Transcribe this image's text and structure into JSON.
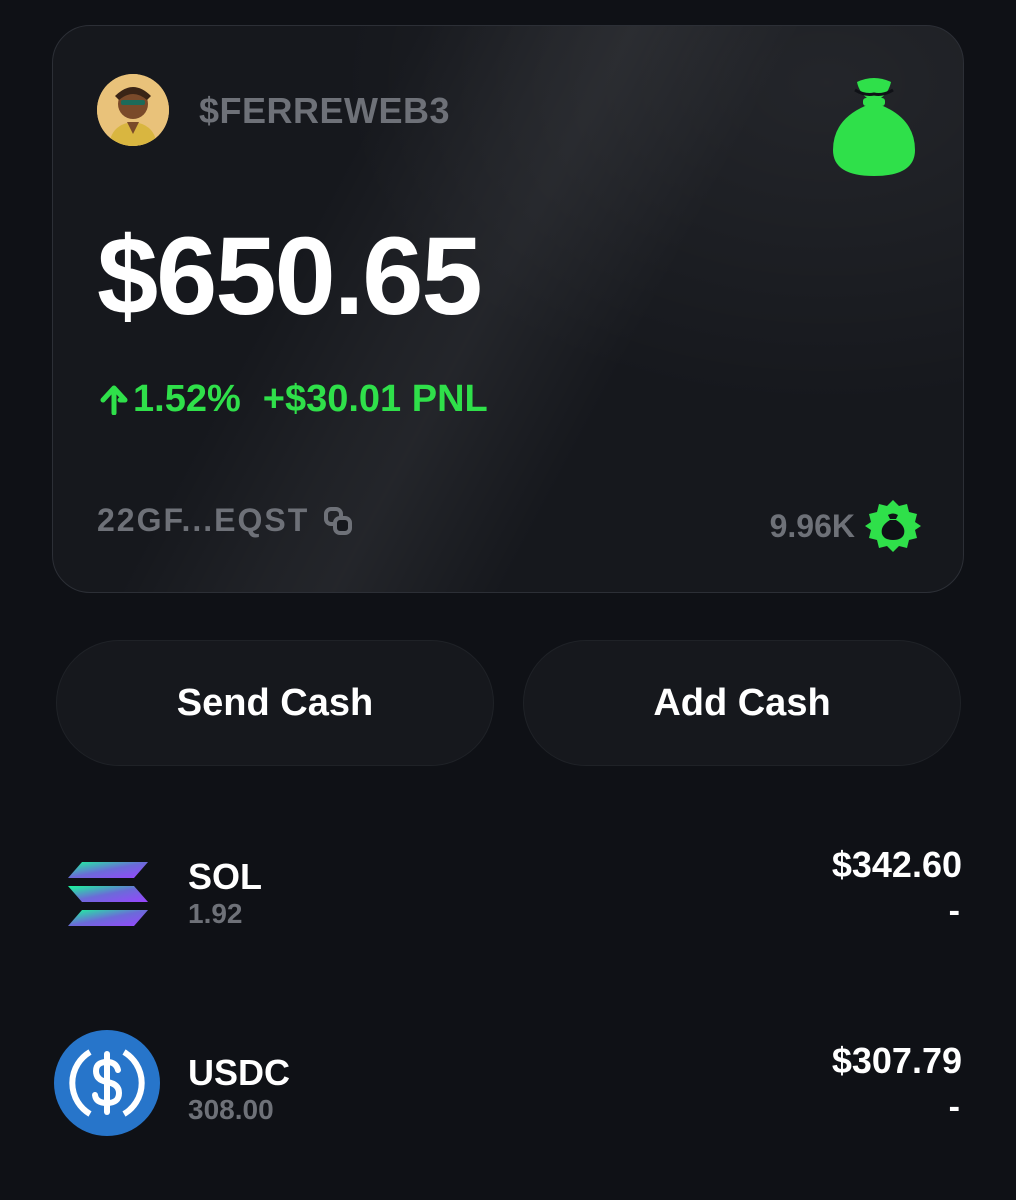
{
  "wallet": {
    "username": "$FERREWEB3",
    "balance": "$650.65",
    "change_percent": "1.52%",
    "pnl": "+$30.01 PNL",
    "address": "22GF...EQST",
    "points": "9.96K",
    "icons": {
      "avatar": "avatar",
      "bag": "money-bag-icon",
      "up_arrow": "up-arrow-icon",
      "copy": "copy-icon",
      "badge": "money-bag-badge-icon"
    }
  },
  "actions": {
    "send_label": "Send Cash",
    "add_label": "Add Cash"
  },
  "assets": [
    {
      "symbol": "SOL",
      "amount": "1.92",
      "value": "$342.60",
      "change": "-",
      "icon": "solana-icon"
    },
    {
      "symbol": "USDC",
      "amount": "308.00",
      "value": "$307.79",
      "change": "-",
      "icon": "usdc-icon"
    }
  ],
  "colors": {
    "background": "#0f1116",
    "card": "#16181d",
    "accent_green": "#2fe04a",
    "muted_text": "#6e7178",
    "usdc_blue": "#2775ca"
  }
}
